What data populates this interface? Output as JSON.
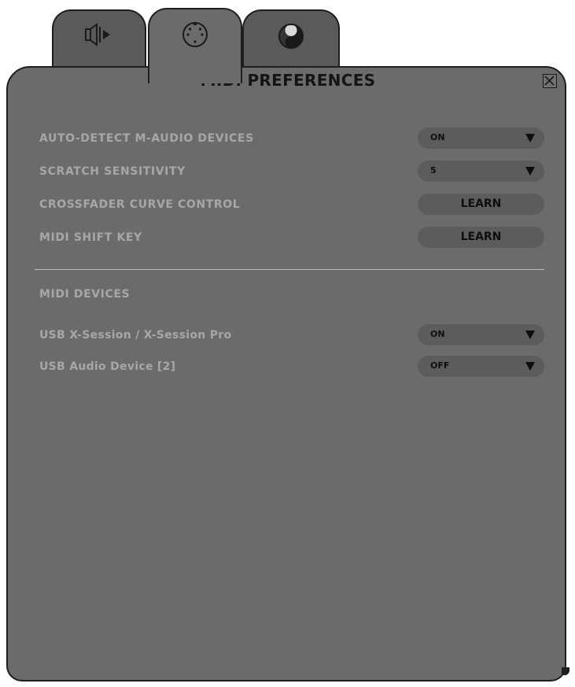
{
  "tabs": [
    {
      "name": "audio",
      "icon": "speaker-icon",
      "active": false
    },
    {
      "name": "midi",
      "icon": "midi-connector-icon",
      "active": true
    },
    {
      "name": "theme",
      "icon": "yin-yang-icon",
      "active": false
    }
  ],
  "panel": {
    "title": "MIDI PREFERENCES",
    "close_icon": "close-icon"
  },
  "settings": [
    {
      "label": "AUTO-DETECT M-AUDIO DEVICES",
      "control": "dropdown",
      "value": "ON"
    },
    {
      "label": "SCRATCH SENSITIVITY",
      "control": "dropdown",
      "value": "5"
    },
    {
      "label": "CROSSFADER CURVE CONTROL",
      "control": "button",
      "value": "LEARN"
    },
    {
      "label": "MIDI SHIFT KEY",
      "control": "button",
      "value": "LEARN"
    }
  ],
  "midi_devices": {
    "heading": "MIDI DEVICES",
    "devices": [
      {
        "label": "USB X-Session / X-Session Pro",
        "value": "ON"
      },
      {
        "label": "USB Audio Device [2]",
        "value": "OFF"
      }
    ]
  },
  "colors": {
    "panel_bg": "#6b6b6b",
    "control_bg": "#5c5c5c",
    "label_text": "#a7a7a7",
    "outline": "#1e1e1e"
  }
}
